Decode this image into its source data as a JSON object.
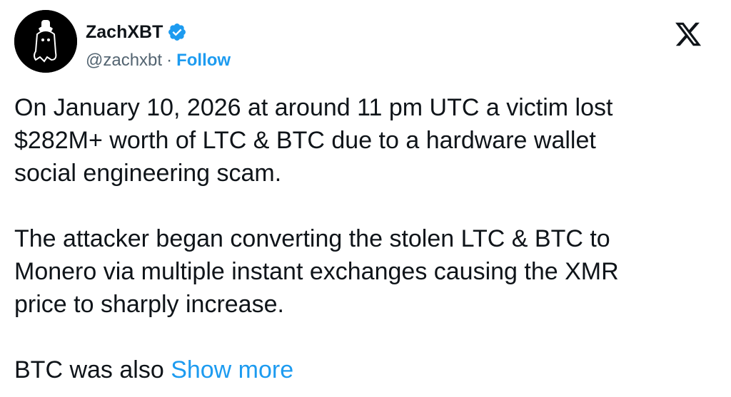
{
  "author": {
    "display_name": "ZachXBT",
    "verified": true,
    "handle": "@zachxbt",
    "separator": "·",
    "follow_label": "Follow",
    "avatar_icon": "detective-ghost-avatar-icon"
  },
  "platform": {
    "logo_icon": "x-logo-icon"
  },
  "tweet": {
    "lines_p1": [
      "On January 10, 2026 at around 11 pm UTC a victim lost",
      "$282M+ worth of LTC & BTC due to a hardware wallet",
      "social engineering scam."
    ],
    "lines_p2": [
      "The attacker began converting the stolen LTC & BTC to",
      "Monero via multiple instant exchanges causing the XMR",
      "price to sharply increase."
    ],
    "p3_text": "BTC was also ",
    "show_more_label": "Show more"
  },
  "colors": {
    "text": "#0f1419",
    "secondary": "#536471",
    "accent": "#1d9bf0"
  }
}
